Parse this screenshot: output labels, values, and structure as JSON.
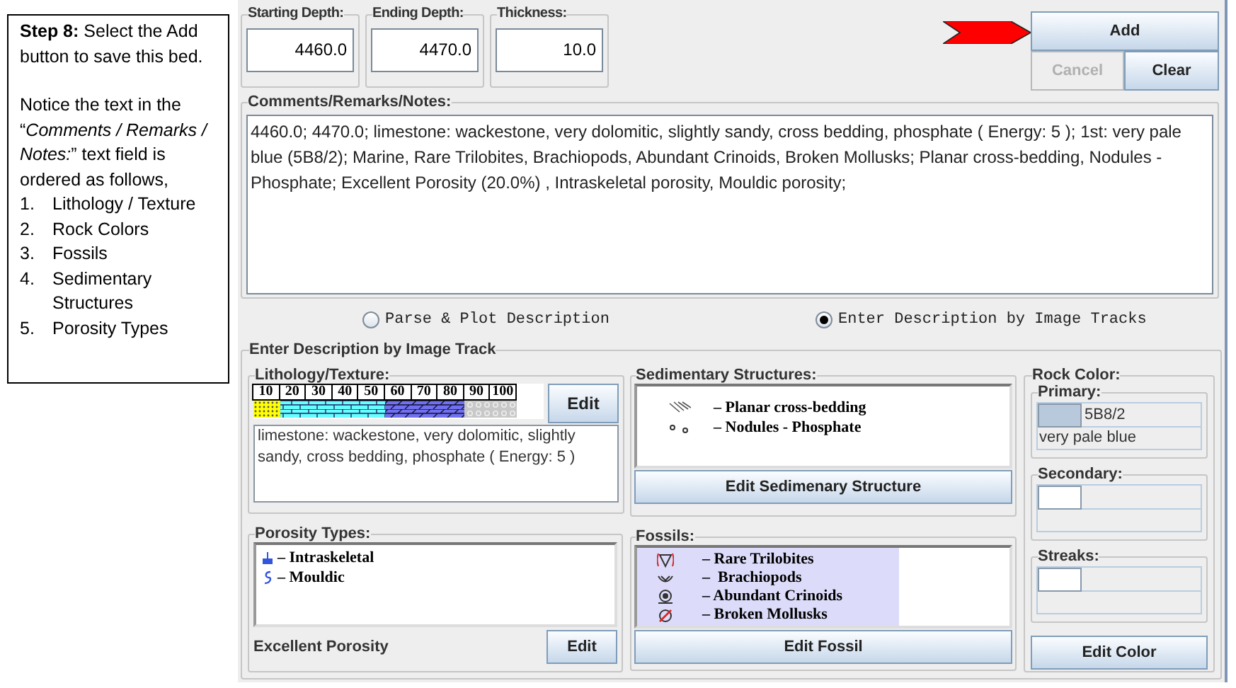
{
  "instructions": {
    "intro": "**Step 8:** Select the Add button to save this bed.",
    "note": "Notice the text in the “*Comments / Remarks / Notes:*” text field is ordered as follows,",
    "steps": [
      {
        "number": "1.",
        "text": "Lithology / Texture"
      },
      {
        "number": "2.",
        "text": "Rock Colors"
      },
      {
        "number": "3.",
        "text": "Fossils"
      },
      {
        "number": "4.",
        "text": "Sedimentary Structures"
      },
      {
        "number": "5.",
        "text": "Porosity Types"
      }
    ]
  },
  "depth_fields": [
    {
      "label": "Starting Depth:",
      "value": "4460.0"
    },
    {
      "label": "Ending Depth:",
      "value": "4470.0"
    },
    {
      "label": "Thickness:",
      "value": "10.0"
    }
  ],
  "buttons": [
    {
      "label": "Add",
      "disabled": false
    },
    {
      "label": "Cancel",
      "disabled": true
    },
    {
      "label": "Clear",
      "disabled": false
    }
  ],
  "comments": {
    "label": "Comments/Remarks/Notes:",
    "value": "4460.0; 4470.0; limestone:  wackestone, very dolomitic, slightly sandy, cross bedding, phosphate ( Energy: 5 ); 1st: very pale blue (5B8/2); Marine, Rare Trilobites, Brachiopods, Abundant Crinoids, Broken Mollusks; Planar cross-bedding, Nodules - Phosphate; Excellent Porosity (20.0%) , Intraskeletal porosity, Mouldic porosity;"
  },
  "modes": [
    {
      "label": "Parse & Plot Description",
      "selected": false
    },
    {
      "label": "Enter Description by Image Tracks",
      "selected": true
    }
  ],
  "image_track": {
    "label": "Enter Description by Image Track",
    "lithology": {
      "label": "Lithology/Texture:",
      "scale": [
        "10",
        "20",
        "30",
        "40",
        "50",
        "60",
        "70",
        "80",
        "90",
        "100"
      ],
      "description": "limestone:  wackestone, very dolomitic, slightly sandy, cross bedding, phosphate ( Energy: 5 )",
      "button": "Edit"
    },
    "porosity": {
      "label": "Porosity Types:",
      "items": [
        "– Intraskeletal",
        "– Mouldic"
      ],
      "summary": "Excellent Porosity",
      "button": "Edit"
    },
    "structures": {
      "label": "Sedimentary Structures:",
      "items": [
        "– Planar cross-bedding",
        "– Nodules - Phosphate"
      ],
      "button": "Edit Sedimenary Structure"
    },
    "fossils": {
      "label": "Fossils:",
      "items": [
        "– Rare Trilobites",
        "–  Brachiopods",
        "– Abundant Crinoids",
        "– Broken Mollusks"
      ],
      "button": "Edit Fossil"
    },
    "rock_color": {
      "label": "Rock Color:",
      "button": "Edit Color",
      "swatches": [
        {
          "label": "Primary:",
          "color": "#b9c9dc",
          "code": "5B8/2",
          "name": "very pale blue"
        },
        {
          "label": "Secondary:",
          "color": "#ffffff"
        },
        {
          "label": "Streaks:",
          "color": "#ffffff"
        }
      ]
    }
  }
}
